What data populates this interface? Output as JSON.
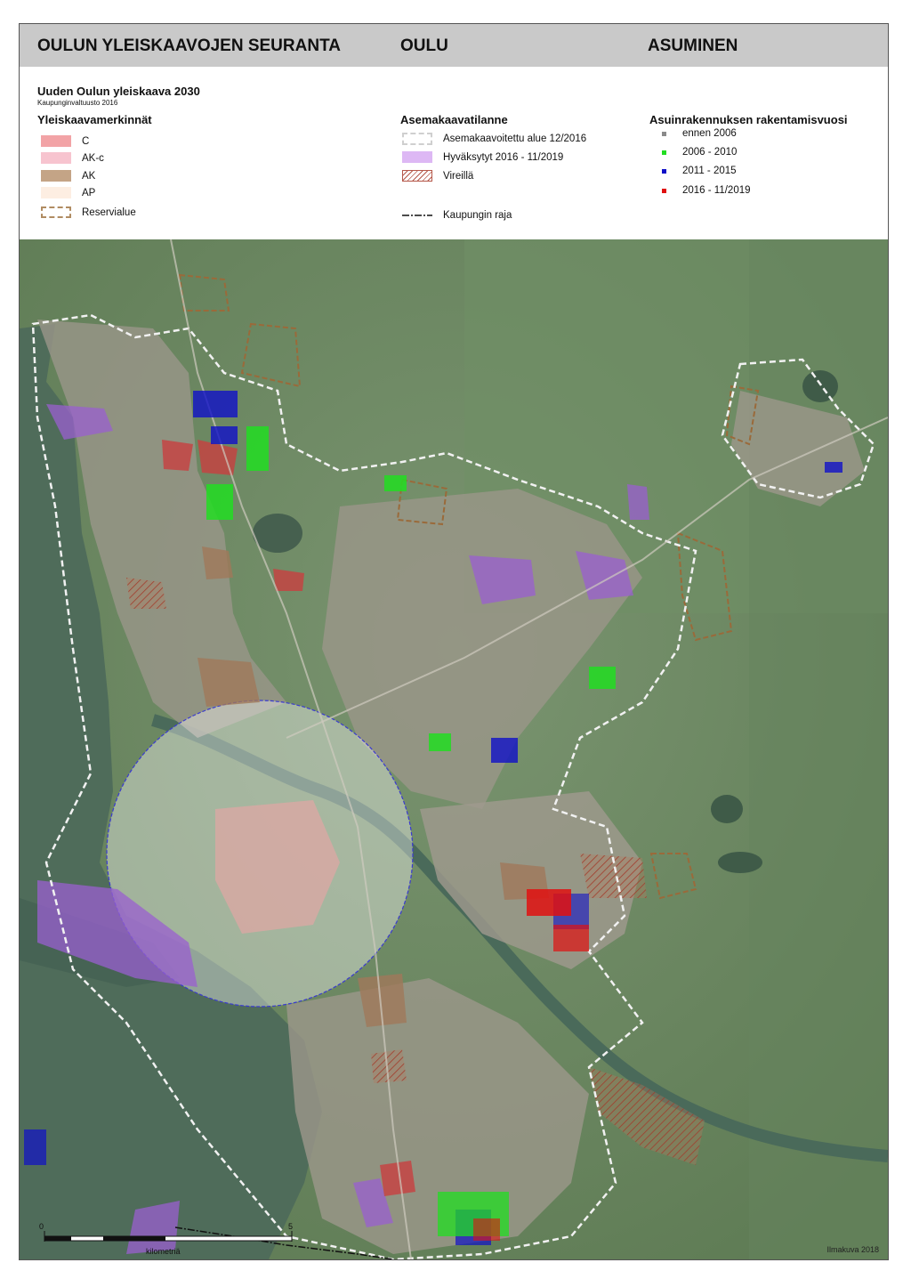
{
  "header": {
    "left_title": "OULUN YLEISKAAVOJEN SEURANTA",
    "center_title": "OULU",
    "right_title": "ASUMINEN"
  },
  "legend": {
    "plan_title": "Uuden Oulun yleiskaava 2030",
    "plan_subtitle": "Kaupunginvaltuusto 2016",
    "plan_markings": {
      "heading": "Yleiskaavamerkinnät",
      "items": [
        {
          "label": "C",
          "color": "#f2a3a6"
        },
        {
          "label": "AK-c",
          "color": "#f7c4cf"
        },
        {
          "label": "AK",
          "color": "#c4a486"
        },
        {
          "label": "AP",
          "color": "#fdeee2"
        },
        {
          "label": "Reservialue",
          "color": "#b08c62"
        }
      ]
    },
    "zoning": {
      "heading": "Asemakaavatilanne",
      "items": [
        {
          "label": "Asemakaavoitettu alue 12/2016",
          "color": "#d8d8d8"
        },
        {
          "label": "Hyväksytyt 2016 - 11/2019",
          "color": "#ddb8f4"
        },
        {
          "label": "Vireillä",
          "color": "#b5584a"
        }
      ],
      "boundary_label": "Kaupungin raja"
    },
    "construction_year": {
      "heading": "Asuinrakennuksen rakentamisvuosi",
      "items": [
        {
          "label": "ennen 2006",
          "color": "#8a8a8a"
        },
        {
          "label": "2006 - 2010",
          "color": "#22dd22"
        },
        {
          "label": "2011 - 2015",
          "color": "#1010c8"
        },
        {
          "label": "2016 - 11/2019",
          "color": "#e01010"
        }
      ]
    }
  },
  "map": {
    "scale_start": "0",
    "scale_end": "5",
    "scale_unit": "kilometriä",
    "credit": "Ilmakuva 2018"
  }
}
